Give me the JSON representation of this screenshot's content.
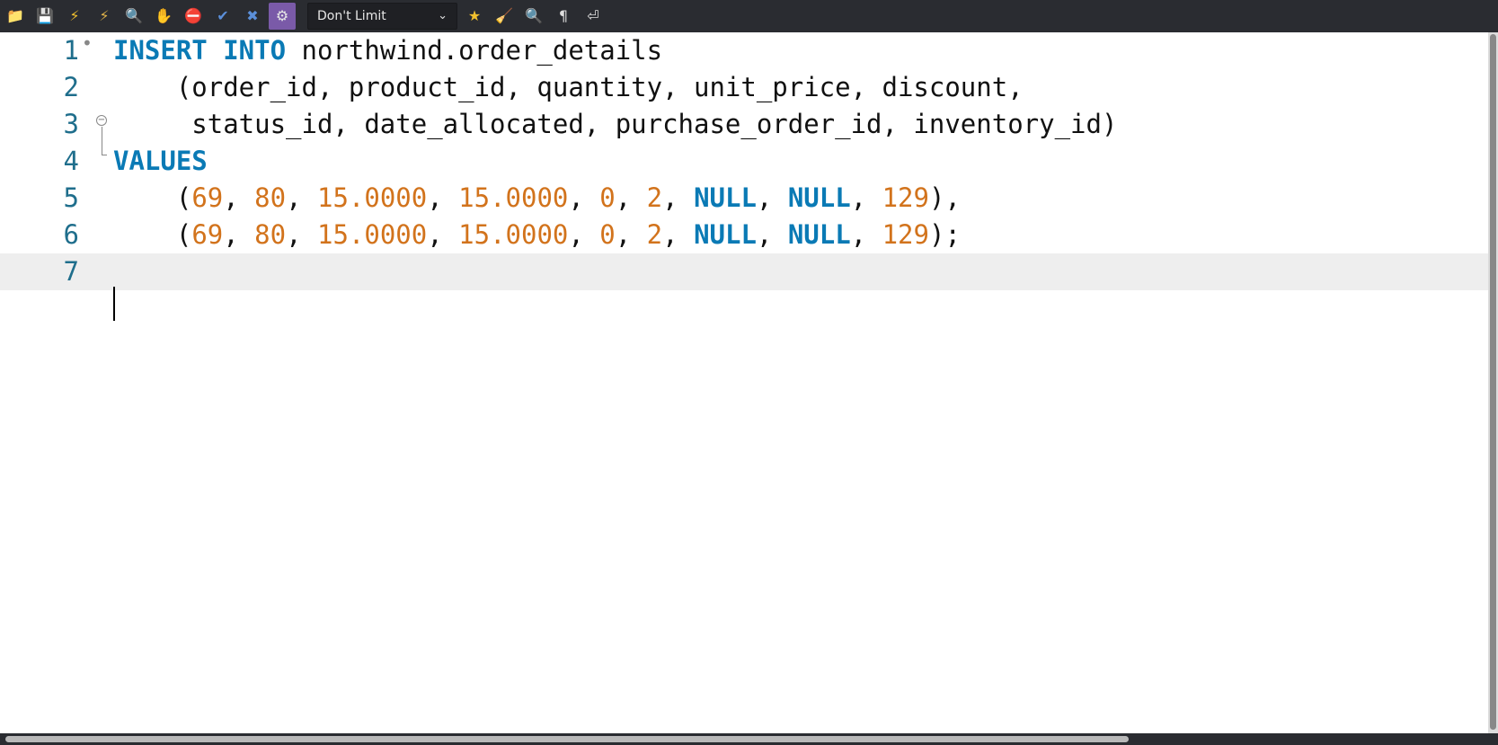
{
  "toolbar": {
    "buttons": [
      {
        "name": "open-file-icon",
        "glyph": "📁",
        "color": "#4f8fd8"
      },
      {
        "name": "save-icon",
        "glyph": "💾",
        "color": "#6fa0d8"
      },
      {
        "name": "execute-icon",
        "glyph": "⚡",
        "color": "#f2c12e"
      },
      {
        "name": "execute-current-icon",
        "glyph": "⚡",
        "color": "#e0b44a"
      },
      {
        "name": "explain-icon",
        "glyph": "🔍",
        "color": "#d9d9d9"
      },
      {
        "name": "stop-icon",
        "glyph": "✋",
        "color": "#c0392b"
      },
      {
        "name": "stop-on-error-icon",
        "glyph": "⛔",
        "color": "#d33"
      },
      {
        "name": "commit-icon",
        "glyph": "✔",
        "color": "#5b8fd9"
      },
      {
        "name": "rollback-icon",
        "glyph": "✖",
        "color": "#5b8fd9"
      },
      {
        "name": "autocommit-icon",
        "glyph": "⚙",
        "color": "#e6e6e6"
      }
    ],
    "limit_select": {
      "value": "Don't Limit"
    },
    "right_buttons": [
      {
        "name": "beautify-icon",
        "glyph": "★",
        "color": "#f2c12e"
      },
      {
        "name": "snippets-icon",
        "glyph": "🧹",
        "color": "#d8a24a"
      },
      {
        "name": "find-icon",
        "glyph": "🔍",
        "color": "#dddddd"
      },
      {
        "name": "invisible-chars-icon",
        "glyph": "¶",
        "color": "#dddddd"
      },
      {
        "name": "word-wrap-icon",
        "glyph": "⏎",
        "color": "#dddddd"
      }
    ]
  },
  "editor": {
    "lines": [
      {
        "n": "1",
        "tokens": [
          {
            "t": "INSERT INTO",
            "c": "kw"
          },
          {
            "t": " northwind.order_details",
            "c": "id"
          }
        ]
      },
      {
        "n": "2",
        "tokens": [
          {
            "t": "    (order_id, product_id, quantity, unit_price, discount,",
            "c": "id"
          }
        ]
      },
      {
        "n": "3",
        "tokens": [
          {
            "t": "     status_id, date_allocated, purchase_order_id, inventory_id)",
            "c": "id"
          }
        ]
      },
      {
        "n": "4",
        "tokens": [
          {
            "t": "VALUES",
            "c": "kw"
          }
        ]
      },
      {
        "n": "5",
        "tokens": [
          {
            "t": "    (",
            "c": "id"
          },
          {
            "t": "69",
            "c": "num"
          },
          {
            "t": ", ",
            "c": "id"
          },
          {
            "t": "80",
            "c": "num"
          },
          {
            "t": ", ",
            "c": "id"
          },
          {
            "t": "15.0000",
            "c": "num"
          },
          {
            "t": ", ",
            "c": "id"
          },
          {
            "t": "15.0000",
            "c": "num"
          },
          {
            "t": ", ",
            "c": "id"
          },
          {
            "t": "0",
            "c": "num"
          },
          {
            "t": ", ",
            "c": "id"
          },
          {
            "t": "2",
            "c": "num"
          },
          {
            "t": ", ",
            "c": "id"
          },
          {
            "t": "NULL",
            "c": "kw"
          },
          {
            "t": ", ",
            "c": "id"
          },
          {
            "t": "NULL",
            "c": "kw"
          },
          {
            "t": ", ",
            "c": "id"
          },
          {
            "t": "129",
            "c": "num"
          },
          {
            "t": "),",
            "c": "id"
          }
        ]
      },
      {
        "n": "6",
        "tokens": [
          {
            "t": "    (",
            "c": "id"
          },
          {
            "t": "69",
            "c": "num"
          },
          {
            "t": ", ",
            "c": "id"
          },
          {
            "t": "80",
            "c": "num"
          },
          {
            "t": ", ",
            "c": "id"
          },
          {
            "t": "15.0000",
            "c": "num"
          },
          {
            "t": ", ",
            "c": "id"
          },
          {
            "t": "15.0000",
            "c": "num"
          },
          {
            "t": ", ",
            "c": "id"
          },
          {
            "t": "0",
            "c": "num"
          },
          {
            "t": ", ",
            "c": "id"
          },
          {
            "t": "2",
            "c": "num"
          },
          {
            "t": ", ",
            "c": "id"
          },
          {
            "t": "NULL",
            "c": "kw"
          },
          {
            "t": ", ",
            "c": "id"
          },
          {
            "t": "NULL",
            "c": "kw"
          },
          {
            "t": ", ",
            "c": "id"
          },
          {
            "t": "129",
            "c": "num"
          },
          {
            "t": ");",
            "c": "id"
          }
        ]
      },
      {
        "n": "7",
        "tokens": []
      }
    ],
    "current_line": "7",
    "colors": {
      "keyword": "#0a7ab5",
      "number": "#d2731c",
      "identifier": "#111111",
      "line_number": "#1f6e8c"
    }
  }
}
